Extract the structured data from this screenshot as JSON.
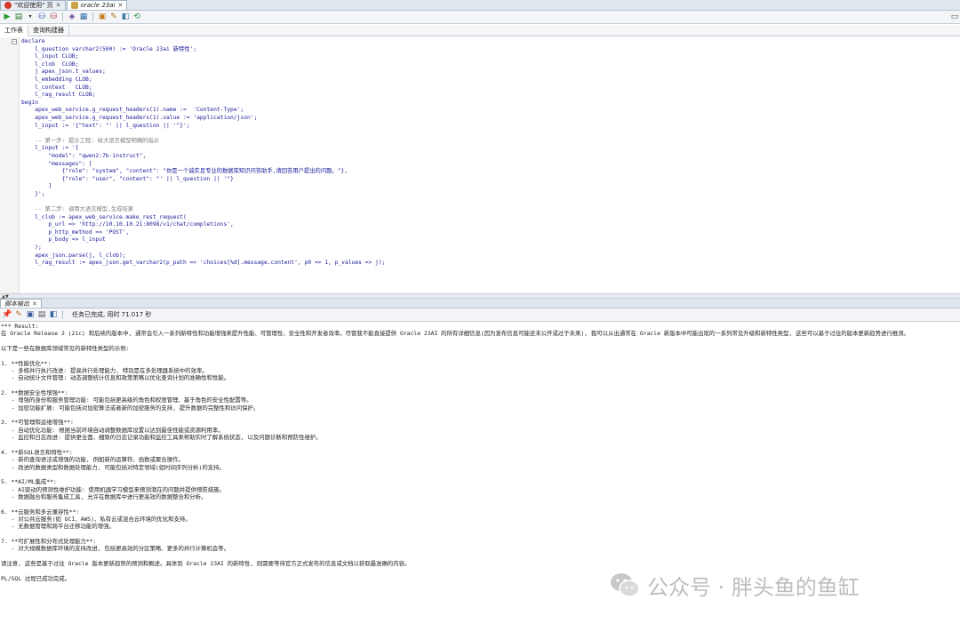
{
  "tabs": [
    {
      "label": "\"欢迎使用\" 页",
      "icon": "oracle-icon",
      "active": false
    },
    {
      "label": "oracle 23ai",
      "icon": "database-icon",
      "active": true
    }
  ],
  "toolbar_icons": [
    "run-icon",
    "run-script-icon",
    "dropdown-icon",
    "commit-icon",
    "rollback-icon",
    "sql-tuning-icon",
    "explain-plan-icon",
    "autotrace-icon",
    "clear-icon",
    "format-icon",
    "history-icon",
    "sql-worksheet-icon"
  ],
  "subtabs": [
    "工作表",
    "查询构建器"
  ],
  "editor_code": [
    "declare",
    "    l_question varchar2(500) := 'Oracle 23ai 新特性';",
    "    l_input CLOB;",
    "    l_clob  CLOB;",
    "    j apex_json.t_values;",
    "    l_embedding CLOB;",
    "    l_context   CLOB;",
    "    l_rag_result CLOB;",
    "begin",
    "    apex_web_service.g_request_headers(1).name :=  'Content-Type';",
    "    apex_web_service.g_request_headers(1).value := 'application/json';",
    "    l_input := '{\"text\": \"' || l_question || '\"}';",
    "",
    "    -- 第一步: 提示工程: 给大语言模型明确的指示",
    "    l_input := '{",
    "        \"model\": \"qwen2:7b-instruct\",",
    "        \"messages\": [",
    "            {\"role\": \"system\", \"content\": \"你是一个诚实且专业的数据库知识问答助手,请回答用户提出的问题。\"},",
    "            {\"role\": \"user\", \"content\": \"' || l_question || '\"}",
    "        ]",
    "    }';",
    "",
    "    -- 第二步: 调用大语言模型,生成结果",
    "    l_clob := apex_web_service.make_rest_request(",
    "        p_url => 'http://10.10.10.21:8098/v1/chat/completions',",
    "        p_http_method => 'POST',",
    "        p_body => l_input",
    "    );",
    "    apex_json.parse(j, l_clob);",
    "    l_rag_result := apex_json.get_varchar2(p_path => 'choices[%d].message.content', p0 => 1, p_values => j);",
    ""
  ],
  "output_tab": "脚本输出",
  "output_status": "任务已完成, 用时 71.017 秒",
  "output_lines": [
    "*** Result:",
    "在 Oracle Release 2 (21c) 和后续的版本中, 通常会引入一系列新特性和功能增强来提升性能、可管理性、安全性和开发者效率。尽管我不能直接提供 Oracle 23AI 的所有详细信息(因为发布信息可能还未公开或过于未来), 我可以从出通常在 Oracle 新版本中可能出现的一系列常见升级和新特性类型, 这些可以基于过往的版本更新趋势进行推测。",
    "",
    "以下是一些在数据库领域常见的新特性类型的示例:",
    "",
    "1. **性能优化**:",
    "   - 多核并行执行改进: 提高并行处理能力, 特别是在多处理器系统中的效率。",
    "   - 自动统计文件管理: 动态调整统计信息和政策策略以优化查询计划的准确性和性能。",
    "",
    "2. **数据安全性增强**:",
    "   - 增强的身份和服务管理功能: 可能包括更高级的角色和权限管理、基于角色的安全性配置等。",
    "   - 加密功能扩展: 可能包括对加密算法或者新的加密服务的支持, 提升数据的完整性和访问保护。",
    "",
    "3. **可管理和运维增强**:",
    "   - 自动优化功能: 根据当前环境自动调整数据库设置以达到最佳性能或资源利用率。",
    "   - 监控和日志改进: 提供更全面、细致的日志记录功能和监控工具来帮助实时了解系统状态, 以及问题诊断和预防性维护。",
    "",
    "4. **新SQL语言和特性**:",
    "   - 新的查询语法或增强的功能, 例如新的运算符、函数或聚合操作。",
    "   - 改进的数据类型和数据处理能力, 可能包括对特定领域(如时间序列分析)的支持。",
    "",
    "5. **AI/ML集成**:",
    "   - AI驱动的预测性维护功能: 使用机器学习模型来预测潜在的问题并提供预防措施。",
    "   - 数据融合和服务集成工具, 允许在数据库中进行更高效的数据整合和分析。",
    "",
    "6. **云服务和多云兼容性**:",
    "   - 对公共云服务(如 OCI、AWS)、私有云或混合云环境的优化和支持。",
    "   - 无数据管理和跨平台迁移功能的增强。",
    "",
    "7. **可扩展性和分布式处理能力**:",
    "   - 对大规模数据库环境的支持改进, 包括更高效的分区策略、更多的并行计算机会等。",
    "",
    "请注意, 这些是基于过往 Oracle 版本更新趋势的预测和概述。具体到 Oracle 23AI 的新特性, 则需要等待官方正式发布的信息或文档以获取最准确的内容。",
    "",
    "PL/SQL 过程已成功完成。"
  ],
  "watermark": "公众号 · 胖头鱼的鱼缸"
}
